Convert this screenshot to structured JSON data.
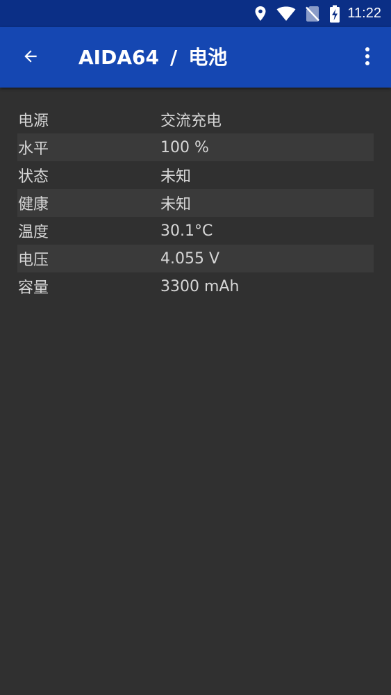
{
  "status_bar": {
    "time": "11:22",
    "icons": [
      "location-icon",
      "wifi-icon",
      "no-sim-icon",
      "battery-charging-icon"
    ]
  },
  "app_bar": {
    "app_name": "AIDA64",
    "separator": "/",
    "page_title": "电池",
    "back_icon": "arrow-back-icon",
    "menu_icon": "more-vert-icon"
  },
  "battery": {
    "rows": [
      {
        "label": "电源",
        "value": "交流充电"
      },
      {
        "label": "水平",
        "value": "100 %"
      },
      {
        "label": "状态",
        "value": "未知"
      },
      {
        "label": "健康",
        "value": "未知"
      },
      {
        "label": "温度",
        "value": "30.1°C"
      },
      {
        "label": "电压",
        "value": "4.055 V"
      },
      {
        "label": "容量",
        "value": "3300 mAh"
      }
    ]
  },
  "colors": {
    "status_bar": "#0b2f86",
    "app_bar": "#1547b2",
    "background": "#303030",
    "row_alt": "#3a3a3a",
    "text": "#d6d6d6"
  }
}
